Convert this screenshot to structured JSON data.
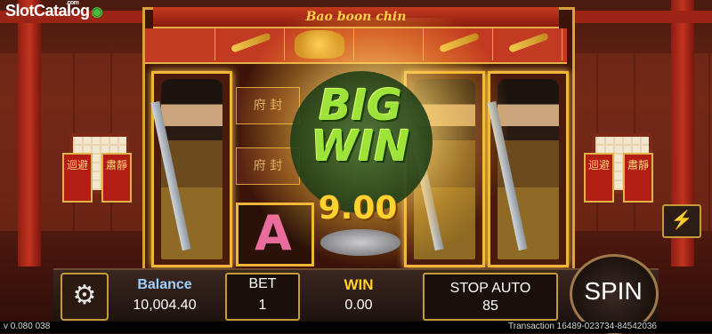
{
  "brand": {
    "name": "SlotCatalog",
    "tld": ".com"
  },
  "game": {
    "title": "Bao boon chin"
  },
  "symbols": {
    "plaque_1": "迴避",
    "plaque_2": "肅靜",
    "plaque_3": "迴避",
    "plaque_4": "肅靜",
    "seal_1": "府 封",
    "seal_2": "府 封",
    "letter_a": "A"
  },
  "big_win": {
    "text": "BIG WIN",
    "amount": "9.00"
  },
  "controls": {
    "balance_label": "Balance",
    "balance_value": "10,004.40",
    "bet_label": "BET",
    "bet_value": "1",
    "win_label": "WIN",
    "win_value": "0.00",
    "stop_auto_label": "STOP AUTO",
    "stop_auto_count": "85",
    "spin_label": "SPIN",
    "settings_icon": "gear-icon",
    "lightning_icon": "lightning-icon"
  },
  "footer": {
    "version": "v 0.080 038",
    "transaction": "Transaction 16489-023734-84542036"
  },
  "colors": {
    "frame_gold": "#d9a23a",
    "win_yellow": "#ffd230",
    "big_win_green": "#9de33a",
    "balance_blue": "#9fd1ff"
  }
}
